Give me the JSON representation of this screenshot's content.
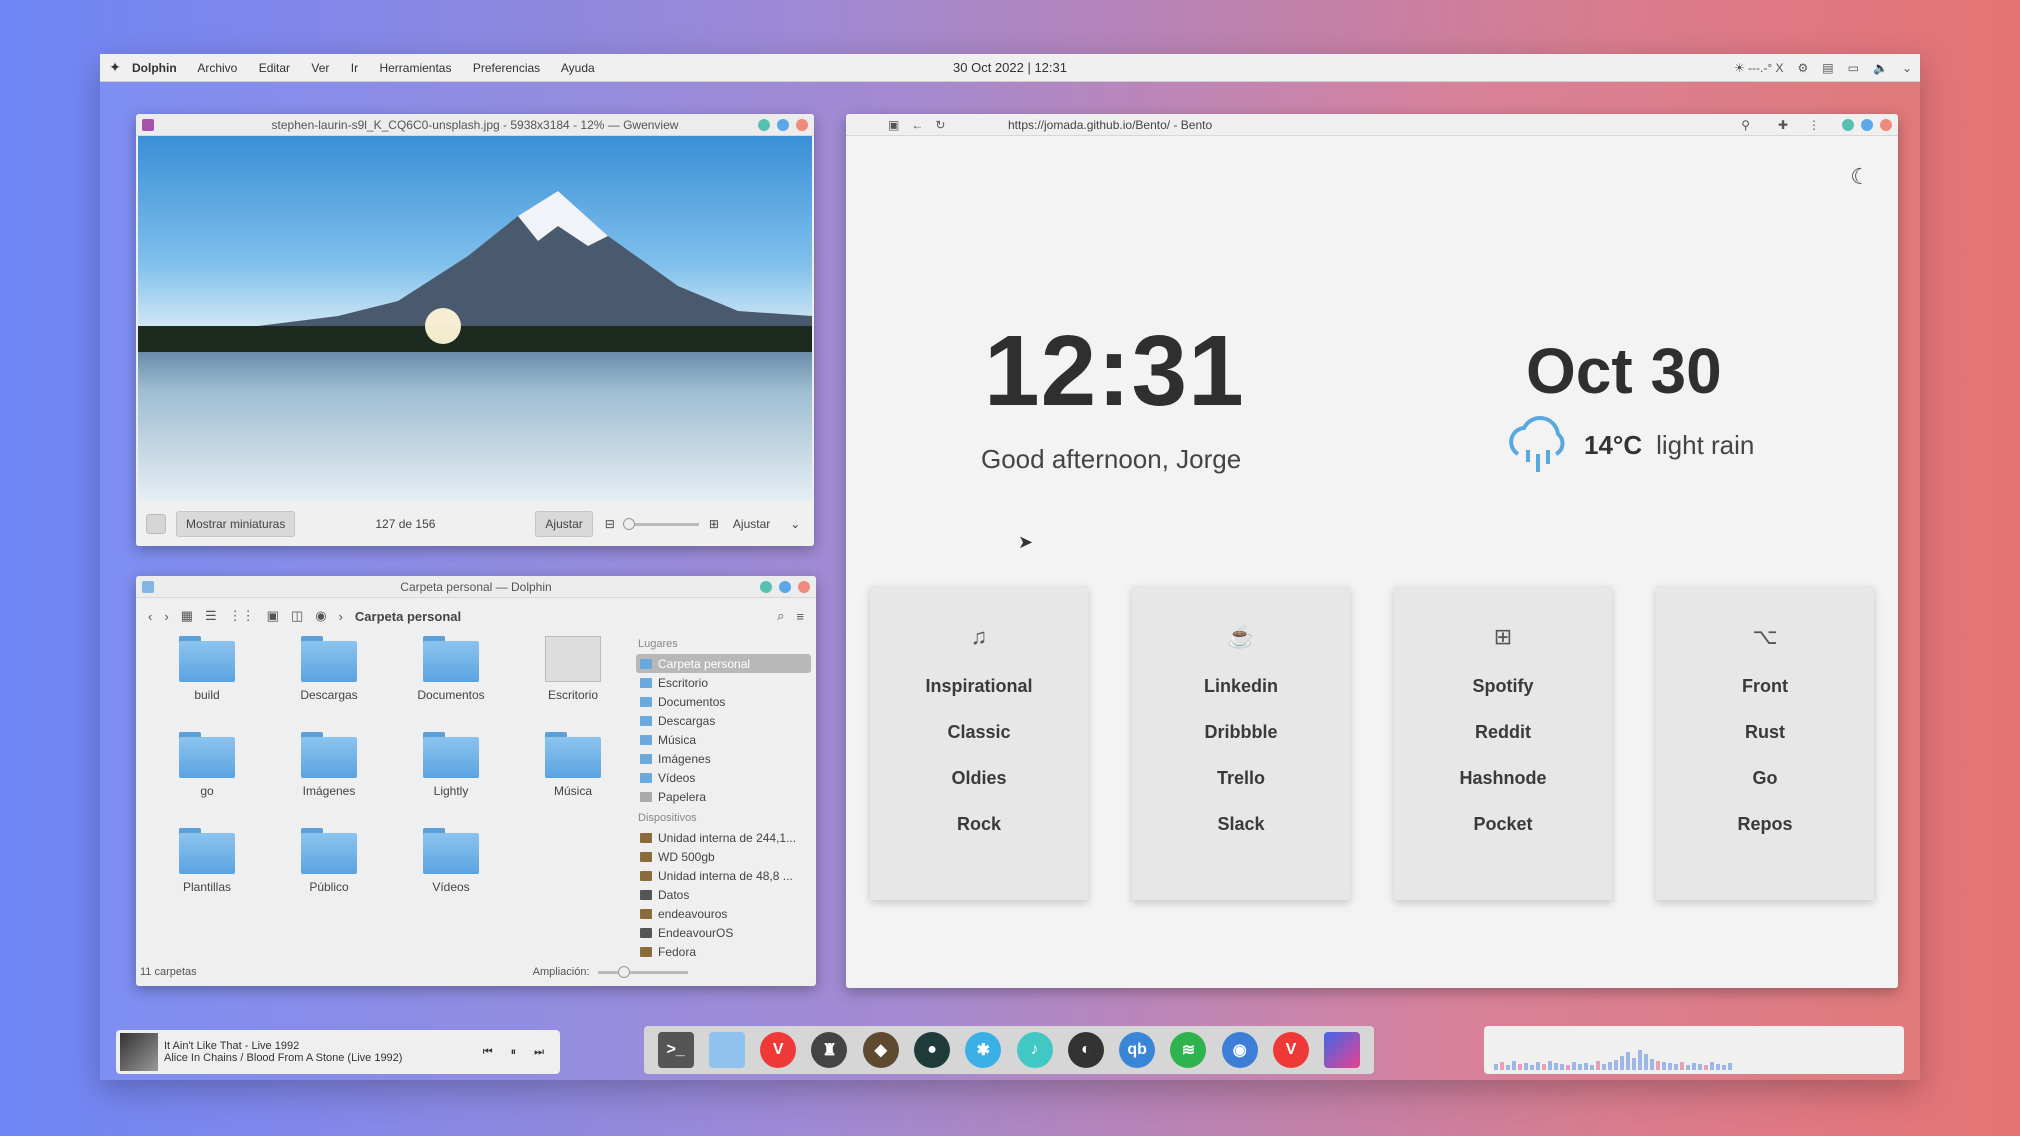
{
  "topbar": {
    "app": "Dolphin",
    "menus": [
      "Archivo",
      "Editar",
      "Ver",
      "Ir",
      "Herramientas",
      "Preferencias",
      "Ayuda"
    ],
    "clock": "30 Oct 2022 | 12:31",
    "tray_temp": "---.-° X"
  },
  "gwenview": {
    "title": "stephen-laurin-s9l_K_CQ6C0-unsplash.jpg - 5938x3184 - 12% — Gwenview",
    "show_thumbs": "Mostrar miniaturas",
    "counter": "127 de 156",
    "fit_button": "Ajustar",
    "zoom_select": "Ajustar"
  },
  "dolphin": {
    "title": "Carpeta personal — Dolphin",
    "breadcrumb": "Carpeta personal",
    "folders": [
      "build",
      "Descargas",
      "Documentos",
      "Escritorio",
      "go",
      "Imágenes",
      "Lightly",
      "Música",
      "Plantillas",
      "Público",
      "Vídeos"
    ],
    "places_header": "Lugares",
    "places": [
      "Carpeta personal",
      "Escritorio",
      "Documentos",
      "Descargas",
      "Música",
      "Imágenes",
      "Vídeos",
      "Papelera"
    ],
    "devices_header": "Dispositivos",
    "devices": [
      "Unidad interna de 244,1...",
      "WD 500gb",
      "Unidad interna de 48,8 ...",
      "Datos",
      "endeavouros",
      "EndeavourOS",
      "Fedora"
    ],
    "status": "11 carpetas",
    "zoom_label": "Ampliación:"
  },
  "browser": {
    "url": "https://jomada.github.io/Bento/ - Bento",
    "time": "12:31",
    "greeting": "Good afternoon, Jorge",
    "date": "Oct 30",
    "temp": "14°C",
    "condition": "light rain",
    "cards": [
      {
        "icon": "music-icon",
        "links": [
          "Inspirational",
          "Classic",
          "Oldies",
          "Rock"
        ]
      },
      {
        "icon": "coffee-icon",
        "links": [
          "Linkedin",
          "Dribbble",
          "Trello",
          "Slack"
        ]
      },
      {
        "icon": "apps-icon",
        "links": [
          "Spotify",
          "Reddit",
          "Hashnode",
          "Pocket"
        ]
      },
      {
        "icon": "github-icon",
        "links": [
          "Front",
          "Rust",
          "Go",
          "Repos"
        ]
      }
    ]
  },
  "player": {
    "track": "It Ain't Like That - Live 1992",
    "artist": "Alice In Chains / Blood From A Stone (Live 1992)"
  },
  "dock": [
    "terminal",
    "files",
    "vivaldi",
    "ghost",
    "cat",
    "circle",
    "kite",
    "music",
    "steam",
    "qbittorrent",
    "spotify",
    "toggle",
    "vivaldi-2",
    "gradient"
  ]
}
